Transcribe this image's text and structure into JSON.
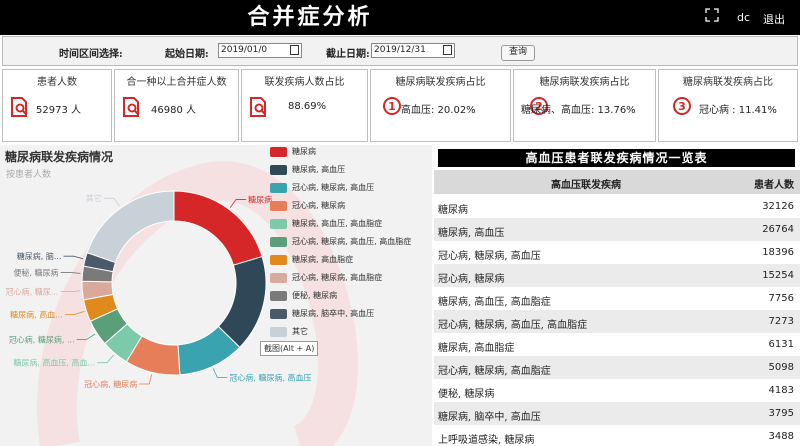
{
  "header": {
    "title": "合并症分析",
    "user": "dc",
    "logout": "退出"
  },
  "filter": {
    "range_label": "时间区间选择:",
    "start_label": "起始日期:",
    "start_value": "2019/01/0",
    "end_label": "截止日期:",
    "end_value": "2019/12/31",
    "query_button": "查询"
  },
  "cards": [
    {
      "title": "患者人数",
      "value": "52973 人",
      "icon": "document-search-icon"
    },
    {
      "title": "合一种以上合并症人数",
      "value": "46980 人",
      "icon": "document-search-icon"
    },
    {
      "title": "联发疾病人数占比",
      "value": "88.69%",
      "icon": "document-search-icon"
    },
    {
      "title": "糖尿病联发疾病占比",
      "rank": "1",
      "value": "高血压: 20.02%"
    },
    {
      "title": "糖尿病联发疾病占比",
      "rank": "2",
      "value": "糖尿病、高血压: 13.76%"
    },
    {
      "title": "糖尿病联发疾病占比",
      "rank": "3",
      "value": "冠心病 : 11.41%"
    }
  ],
  "donut_panel": {
    "title": "糖尿病联发疾病情况",
    "subtitle": "按患者人数",
    "tooltip": "截图(Alt + A)"
  },
  "chart_data": {
    "type": "pie",
    "title": "糖尿病联发疾病情况",
    "subtitle": "按患者人数",
    "series": [
      {
        "values": [
          {
            "name": "糖尿病",
            "value": 32126,
            "color": "#d62728"
          },
          {
            "name": "糖尿病, 高血压",
            "value": 26764,
            "color": "#2f4858"
          },
          {
            "name": "冠心病, 糖尿病, 高血压",
            "value": 18396,
            "color": "#3aa3b0"
          },
          {
            "name": "冠心病, 糖尿病",
            "value": 15254,
            "color": "#e67e5a"
          },
          {
            "name": "糖尿病, 高血压, 高血脂症",
            "value": 7756,
            "color": "#7ccaa9"
          },
          {
            "name": "冠心病, 糖尿病, 高血压, 高血脂症",
            "value": 7273,
            "color": "#5a9e7a"
          },
          {
            "name": "糖尿病, 高血脂症",
            "value": 6131,
            "color": "#e08a1e"
          },
          {
            "name": "冠心病, 糖尿病, 高血脂症",
            "value": 5098,
            "color": "#d9a99c"
          },
          {
            "name": "便秘, 糖尿病",
            "value": 4183,
            "color": "#7a7a7a"
          },
          {
            "name": "糖尿病, 脑卒中, 高血压",
            "value": 3795,
            "color": "#4a5a6a"
          },
          {
            "name": "其它",
            "value": 31000,
            "color": "#c8d0d8"
          }
        ]
      }
    ]
  },
  "donut_outer_labels": [
    {
      "text": "糖尿病",
      "color": "#d62728"
    },
    {
      "text": "冠心病, 糖尿病, 高血压",
      "color": "#3aa3b0"
    },
    {
      "text": "冠心病, 糖尿病",
      "color": "#e67e5a"
    },
    {
      "text": "糖尿病, 高血压, 高血...",
      "color": "#7ccaa9"
    },
    {
      "text": "冠心病, 糖尿病, ...",
      "color": "#5a9e7a"
    },
    {
      "text": "糖尿病, 高血...",
      "color": "#e08a1e"
    },
    {
      "text": "冠心病, 糖尿...",
      "color": "#d9a99c"
    },
    {
      "text": "便秘, 糖尿病",
      "color": "#7a7a7a"
    },
    {
      "text": "糖尿病, 脑...",
      "color": "#4a5a6a"
    },
    {
      "text": "其它",
      "color": "#c8d0d8"
    }
  ],
  "table": {
    "title": "高血压患者联发疾病情况一览表",
    "col1": "高血压联发疾病",
    "col2": "患者人数",
    "rows": [
      {
        "name": "糖尿病",
        "count": "32126"
      },
      {
        "name": "糖尿病, 高血压",
        "count": "26764"
      },
      {
        "name": "冠心病, 糖尿病, 高血压",
        "count": "18396"
      },
      {
        "name": "冠心病, 糖尿病",
        "count": "15254"
      },
      {
        "name": "糖尿病, 高血压, 高血脂症",
        "count": "7756"
      },
      {
        "name": "冠心病, 糖尿病, 高血压, 高血脂症",
        "count": "7273"
      },
      {
        "name": "糖尿病, 高血脂症",
        "count": "6131"
      },
      {
        "name": "冠心病, 糖尿病, 高血脂症",
        "count": "5098"
      },
      {
        "name": "便秘, 糖尿病",
        "count": "4183"
      },
      {
        "name": "糖尿病, 脑卒中, 高血压",
        "count": "3795"
      },
      {
        "name": "上呼吸道感染, 糖尿病",
        "count": "3488"
      }
    ]
  }
}
